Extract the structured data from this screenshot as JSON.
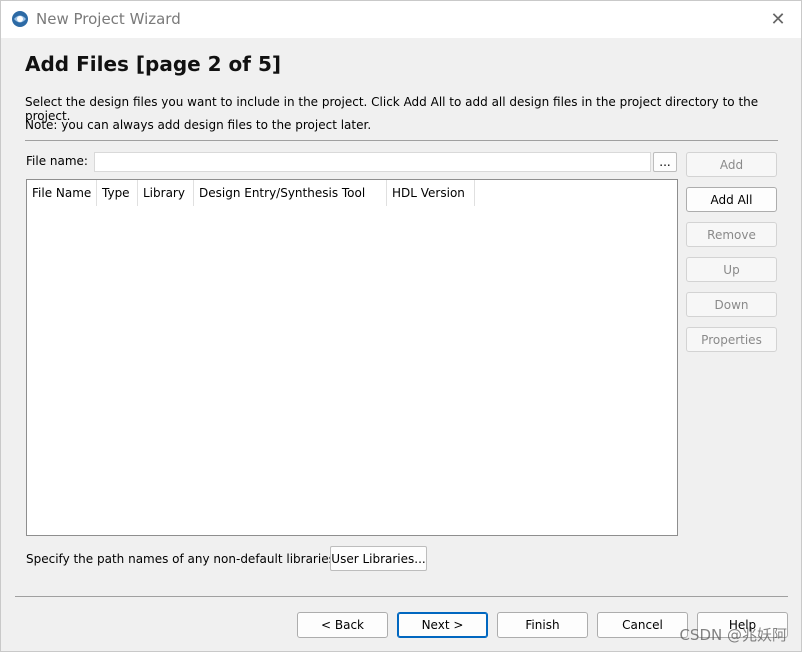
{
  "window": {
    "title": "New Project Wizard"
  },
  "page": {
    "title": "Add Files [page 2 of 5]",
    "description_line1": "Select the design files you want to include in the project. Click Add All to add all design files in the project directory to the project.",
    "description_line2": "Note: you can always add design files to the project later."
  },
  "file_name": {
    "label": "File name:",
    "value": "",
    "browse_label": "..."
  },
  "table": {
    "columns": [
      "File Name",
      "Type",
      "Library",
      "Design Entry/Synthesis Tool",
      "HDL Version"
    ],
    "rows": []
  },
  "side_buttons": {
    "add": "Add",
    "add_all": "Add All",
    "remove": "Remove",
    "up": "Up",
    "down": "Down",
    "properties": "Properties"
  },
  "libraries": {
    "label": "Specify the path names of any non-default libraries.",
    "button": "User Libraries..."
  },
  "footer": {
    "back": "< Back",
    "next": "Next >",
    "finish": "Finish",
    "cancel": "Cancel",
    "help": "Help"
  },
  "watermark": "CSDN @兆妖阿",
  "colors": {
    "title_text": "#7a7a7a",
    "default_button_border": "#0067c0"
  }
}
